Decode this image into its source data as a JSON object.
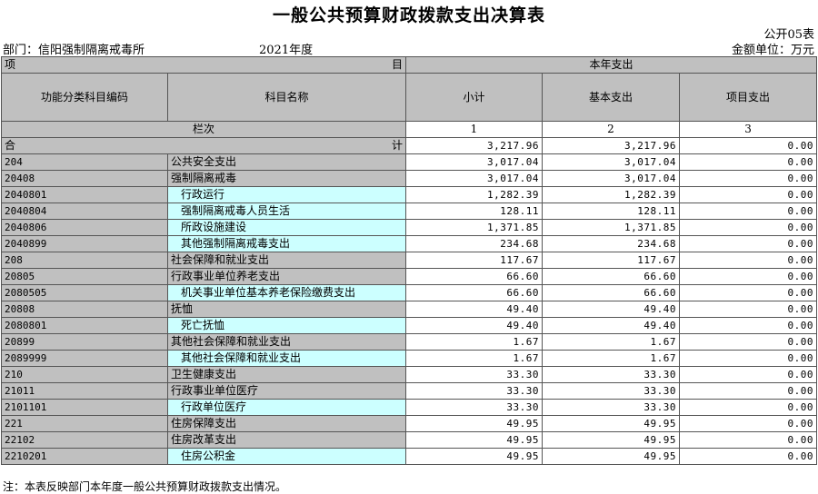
{
  "title": "一般公共预算财政拨款支出决算表",
  "form_no": "公开05表",
  "department": "部门：信阳强制隔离戒毒所",
  "year": "2021年度",
  "unit": "金额单位：万元",
  "header": {
    "item_left": "项",
    "item_right": "目",
    "current_year": "本年支出",
    "code_col": "功能分类科目编码",
    "name_col": "科目名称",
    "subtotal": "小计",
    "basic": "基本支出",
    "project": "项目支出",
    "column_label": "栏次",
    "col1": "1",
    "col2": "2",
    "col3": "3"
  },
  "total": {
    "left": "合",
    "right": "计",
    "subtotal": "3,217.96",
    "basic": "3,217.96",
    "project": "0.00"
  },
  "rows": [
    {
      "code": "204",
      "name": "公共安全支出",
      "subtotal": "3,017.04",
      "basic": "3,017.04",
      "project": "0.00",
      "level": 1
    },
    {
      "code": "20408",
      "name": "强制隔离戒毒",
      "subtotal": "3,017.04",
      "basic": "3,017.04",
      "project": "0.00",
      "level": 2
    },
    {
      "code": "2040801",
      "name": "行政运行",
      "subtotal": "1,282.39",
      "basic": "1,282.39",
      "project": "0.00",
      "level": 3
    },
    {
      "code": "2040804",
      "name": "强制隔离戒毒人员生活",
      "subtotal": "128.11",
      "basic": "128.11",
      "project": "0.00",
      "level": 3
    },
    {
      "code": "2040806",
      "name": "所政设施建设",
      "subtotal": "1,371.85",
      "basic": "1,371.85",
      "project": "0.00",
      "level": 3
    },
    {
      "code": "2040899",
      "name": "其他强制隔离戒毒支出",
      "subtotal": "234.68",
      "basic": "234.68",
      "project": "0.00",
      "level": 3
    },
    {
      "code": "208",
      "name": "社会保障和就业支出",
      "subtotal": "117.67",
      "basic": "117.67",
      "project": "0.00",
      "level": 1
    },
    {
      "code": "20805",
      "name": "行政事业单位养老支出",
      "subtotal": "66.60",
      "basic": "66.60",
      "project": "0.00",
      "level": 2
    },
    {
      "code": "2080505",
      "name": "机关事业单位基本养老保险缴费支出",
      "subtotal": "66.60",
      "basic": "66.60",
      "project": "0.00",
      "level": 3
    },
    {
      "code": "20808",
      "name": "抚恤",
      "subtotal": "49.40",
      "basic": "49.40",
      "project": "0.00",
      "level": 2
    },
    {
      "code": "2080801",
      "name": "死亡抚恤",
      "subtotal": "49.40",
      "basic": "49.40",
      "project": "0.00",
      "level": 3
    },
    {
      "code": "20899",
      "name": "其他社会保障和就业支出",
      "subtotal": "1.67",
      "basic": "1.67",
      "project": "0.00",
      "level": 2
    },
    {
      "code": "2089999",
      "name": "其他社会保障和就业支出",
      "subtotal": "1.67",
      "basic": "1.67",
      "project": "0.00",
      "level": 3
    },
    {
      "code": "210",
      "name": "卫生健康支出",
      "subtotal": "33.30",
      "basic": "33.30",
      "project": "0.00",
      "level": 1
    },
    {
      "code": "21011",
      "name": "行政事业单位医疗",
      "subtotal": "33.30",
      "basic": "33.30",
      "project": "0.00",
      "level": 2
    },
    {
      "code": "2101101",
      "name": "行政单位医疗",
      "subtotal": "33.30",
      "basic": "33.30",
      "project": "0.00",
      "level": 3
    },
    {
      "code": "221",
      "name": "住房保障支出",
      "subtotal": "49.95",
      "basic": "49.95",
      "project": "0.00",
      "level": 1
    },
    {
      "code": "22102",
      "name": "住房改革支出",
      "subtotal": "49.95",
      "basic": "49.95",
      "project": "0.00",
      "level": 2
    },
    {
      "code": "2210201",
      "name": "住房公积金",
      "subtotal": "49.95",
      "basic": "49.95",
      "project": "0.00",
      "level": 3
    }
  ],
  "note": "注：本表反映部门本年度一般公共预算财政拨款支出情况。",
  "colors": {
    "header_gray": "#c0c0c0",
    "leaf_cyan": "#ccffff"
  }
}
